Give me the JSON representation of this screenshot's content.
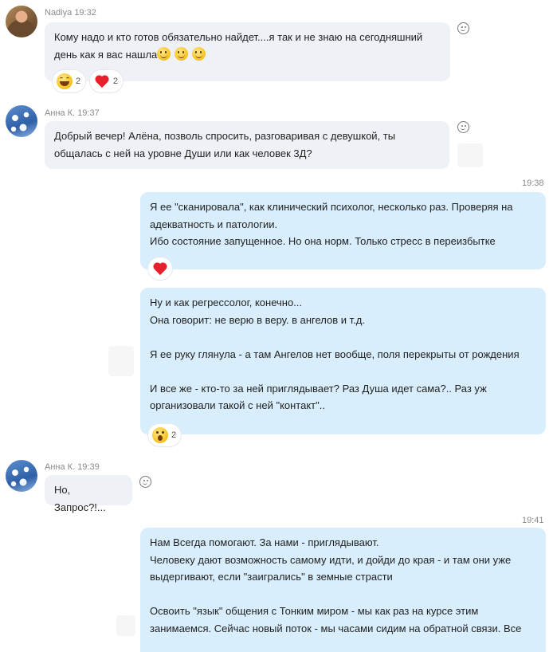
{
  "messages": [
    {
      "sender": "Nadiya",
      "time": "19:32",
      "text": "Кому надо и кто готов обязательно найдет....я так и не знаю на сегодняшний\nдень как я вас нашла",
      "reactions": [
        {
          "icon": "laugh-emoji",
          "count": "2"
        },
        {
          "icon": "heart-emoji",
          "count": "2"
        }
      ]
    },
    {
      "sender": "Анна К.",
      "time": "19:37",
      "text": "Добрый вечер! Алёна, позволь спросить, разговаривая с девушкой, ты\nобщалась с ней на уровне Души или как человек 3Д?"
    },
    {
      "time": "19:38",
      "text": "Я ее \"сканировала\", как клинический психолог, несколько раз. Проверяя на\nадекватность и патологии.\nИбо состояние запущенное. Но она норм. Только стресс в переизбытке",
      "reactions": [
        {
          "icon": "heart-emoji"
        }
      ]
    },
    {
      "text": "Ну и как регрессолог, конечно...\nОна говорит: не верю в веру. в ангелов и т.д.\n\nЯ ее руку глянула - а там Ангелов нет вообще, поля перекрыты от рождения\n\nИ все же - кто-то за ней приглядывает? Раз Душа идет сама?.. Раз уж\nорганизовали такой с ней \"контакт\"..",
      "reactions": [
        {
          "icon": "shocked-emoji",
          "count": "2"
        }
      ]
    },
    {
      "sender": "Анна К.",
      "time": "19:39",
      "text": "Но, Запрос?!..."
    },
    {
      "time": "19:41",
      "text": "Нам Всегда помогают. За нами - приглядывают.\nЧеловеку дают возможность самому идти, и дойди до края - и там они уже\nвыдергивают, если \"заигрались\" в земные страсти\n\nОсвоить \"язык\" общения с Тонким миром - мы как раз на курсе этим\nзанимаемся. Сейчас новый поток - мы часами сидим на обратной связи. Все"
    }
  ]
}
